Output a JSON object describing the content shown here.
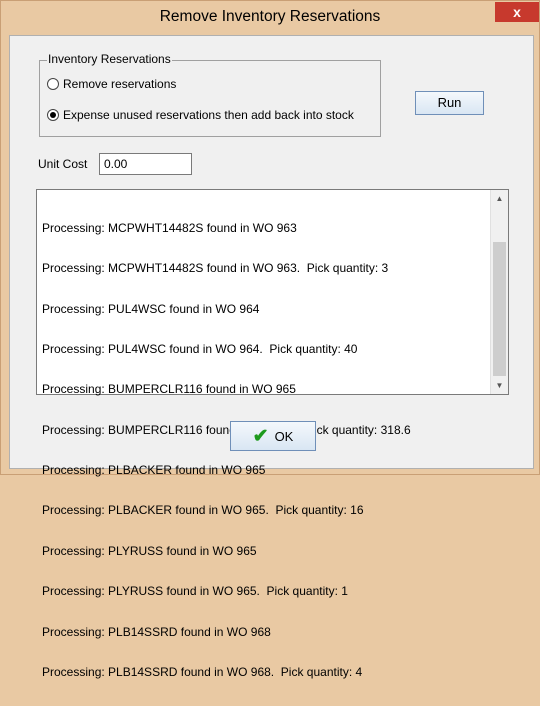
{
  "window": {
    "title": "Remove Inventory Reservations",
    "close_glyph": "x"
  },
  "group": {
    "title": "Inventory Reservations",
    "options": [
      {
        "label": "Remove reservations",
        "checked": false
      },
      {
        "label": "Expense unused reservations then add back into stock",
        "checked": true
      }
    ]
  },
  "run_button": {
    "label": "Run"
  },
  "unit_cost": {
    "label": "Unit Cost",
    "value": "0.00"
  },
  "log": {
    "lines": [
      "Processing: MCPWHT14482S found in WO 963",
      "Processing: MCPWHT14482S found in WO 963.  Pick quantity: 3",
      "Processing: PUL4WSC found in WO 964",
      "Processing: PUL4WSC found in WO 964.  Pick quantity: 40",
      "Processing: BUMPERCLR116 found in WO 965",
      "Processing: BUMPERCLR116 found in WO 965.  Pick quantity: 318.6",
      "Processing: PLBACKER found in WO 965",
      "Processing: PLBACKER found in WO 965.  Pick quantity: 16",
      "Processing: PLYRUSS found in WO 965",
      "Processing: PLYRUSS found in WO 965.  Pick quantity: 1",
      "Processing: PLB14SSRD found in WO 968",
      "Processing: PLB14SSRD found in WO 968.  Pick quantity: 4"
    ]
  },
  "ok_button": {
    "label": "OK",
    "icon": "checkmark-icon",
    "icon_color": "#1d9a1d"
  },
  "colors": {
    "frame": "#e9c9a3",
    "close": "#c7392d",
    "client": "#f0f0f0"
  }
}
